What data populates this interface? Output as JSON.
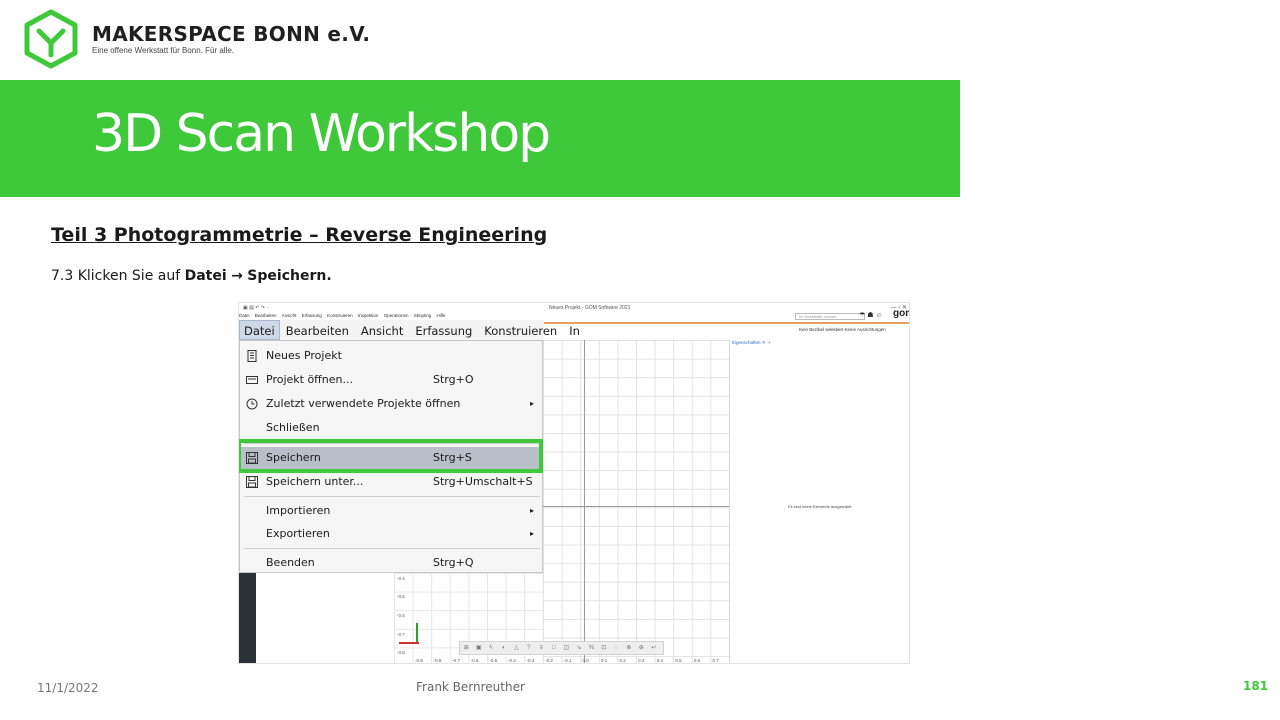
{
  "header": {
    "brand_name": "MAKERSPACE BONN e.V.",
    "brand_tagline": "Eine offene Werkstatt für Bonn. Für alle.",
    "accent_color": "#3ec83a"
  },
  "banner": {
    "title": "3D Scan Workshop"
  },
  "content": {
    "section_heading": "Teil 3  Photogrammetrie  – Reverse Engineering",
    "step_prefix": "7.3 Klicken Sie auf ",
    "step_bold_1": "Datei",
    "step_arrow": "→",
    "step_bold_2": "Speichern",
    "step_suffix": "."
  },
  "screenshot": {
    "window_title": "Neues Projekt - GOM Software 2021",
    "mini_menu": [
      "Datei",
      "Bearbeiten",
      "Ansicht",
      "Erfassung",
      "Konstruieren",
      "Inspektion",
      "Operationen",
      "Skripting",
      "Hilfe"
    ],
    "search_placeholder": "Im Direkthilfe suchen",
    "logo_text": "gom",
    "status_right": "Kein Bezibel selektiert  Keine Ausrichtungen",
    "menubar": [
      "Datei",
      "Bearbeiten",
      "Ansicht",
      "Erfassung",
      "Konstruieren",
      "In"
    ],
    "dropdown": {
      "items": [
        {
          "label": "Neues Projekt",
          "shortcut": "",
          "icon": "document-icon"
        },
        {
          "label": "Projekt öffnen...",
          "shortcut": "Strg+O",
          "icon": "folder-open-icon"
        },
        {
          "label": "Zuletzt verwendete Projekte öffnen",
          "shortcut": "",
          "icon": "clock-icon",
          "submenu": true
        },
        {
          "label": "Schließen",
          "shortcut": ""
        },
        {
          "label": "Speichern",
          "shortcut": "Strg+S",
          "icon": "save-icon",
          "highlighted": true
        },
        {
          "label": "Speichern unter...",
          "shortcut": "Strg+Umschalt+S",
          "icon": "save-as-icon"
        },
        {
          "label": "Importieren",
          "shortcut": "",
          "submenu": true
        },
        {
          "label": "Exportieren",
          "shortcut": "",
          "submenu": true
        },
        {
          "label": "Beenden",
          "shortcut": "Strg+Q"
        }
      ]
    },
    "props_tab": "Eigenschaften",
    "props_empty_text": "Es sind keine Elemente ausgewählt.",
    "y_ticks": [
      "-0.4",
      "-0.5",
      "-0.6",
      "-0.7",
      "-0.8"
    ],
    "x_ticks": [
      "-0.9",
      "-0.8",
      "-0.7",
      "-0.6",
      "-0.5",
      "-0.4",
      "-0.3",
      "-0.2",
      "-0.1",
      "0.0",
      "0.1",
      "0.2",
      "0.3",
      "0.4",
      "0.5",
      "0.6",
      "0.7"
    ]
  },
  "footer": {
    "date": "11/1/2022",
    "author": "Frank Bernreuther",
    "page": "181"
  }
}
